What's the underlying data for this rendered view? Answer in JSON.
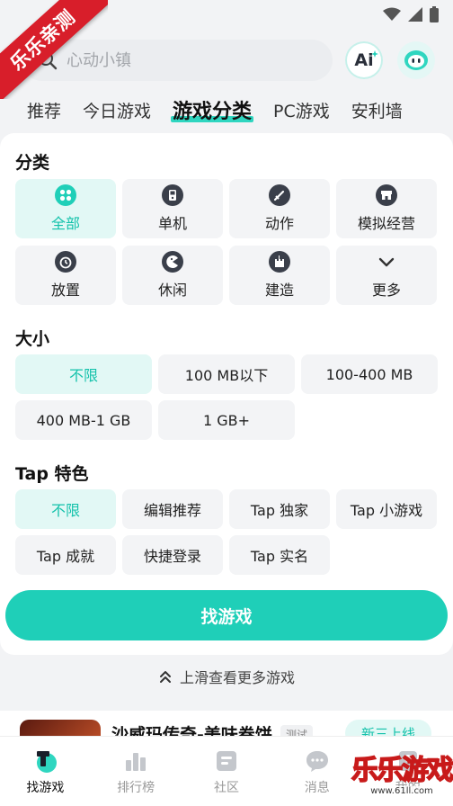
{
  "ribbon": "乐乐亲测",
  "search": {
    "placeholder": "心动小镇"
  },
  "header": {
    "ai_label": "Ai"
  },
  "tabs": [
    "推荐",
    "今日游戏",
    "游戏分类",
    "PC游戏",
    "安利墙"
  ],
  "category": {
    "title": "分类",
    "items": [
      {
        "label": "全部",
        "icon": "grid-icon"
      },
      {
        "label": "单机",
        "icon": "gamepad-icon"
      },
      {
        "label": "动作",
        "icon": "sword-icon"
      },
      {
        "label": "模拟经营",
        "icon": "shop-icon"
      },
      {
        "label": "放置",
        "icon": "alarm-icon"
      },
      {
        "label": "休闲",
        "icon": "pacman-icon"
      },
      {
        "label": "建造",
        "icon": "castle-icon"
      },
      {
        "label": "更多",
        "icon": "chevron-down-icon"
      }
    ]
  },
  "size": {
    "title": "大小",
    "items": [
      "不限",
      "100 MB以下",
      "100-400 MB",
      "400 MB-1 GB",
      "1 GB+"
    ]
  },
  "tap": {
    "title": "Tap 特色",
    "items": [
      "不限",
      "编辑推荐",
      "Tap 独家",
      "Tap 小游戏",
      "Tap 成就",
      "快捷登录",
      "Tap 实名"
    ]
  },
  "find_button": "找游戏",
  "more_hint": "上滑查看更多游戏",
  "game": {
    "title": "沙威玛传奇-美味卷饼",
    "tag": "测试",
    "action": "新三上线"
  },
  "bottom_nav": [
    "找游戏",
    "排行榜",
    "社区",
    "消息",
    "我的"
  ],
  "watermark": {
    "text": "乐乐游戏",
    "url": "www.61ll.com"
  },
  "colors": {
    "accent": "#1fcfb8",
    "active_chip_bg": "#e2f8f5",
    "ribbon": "#d81e2a"
  }
}
